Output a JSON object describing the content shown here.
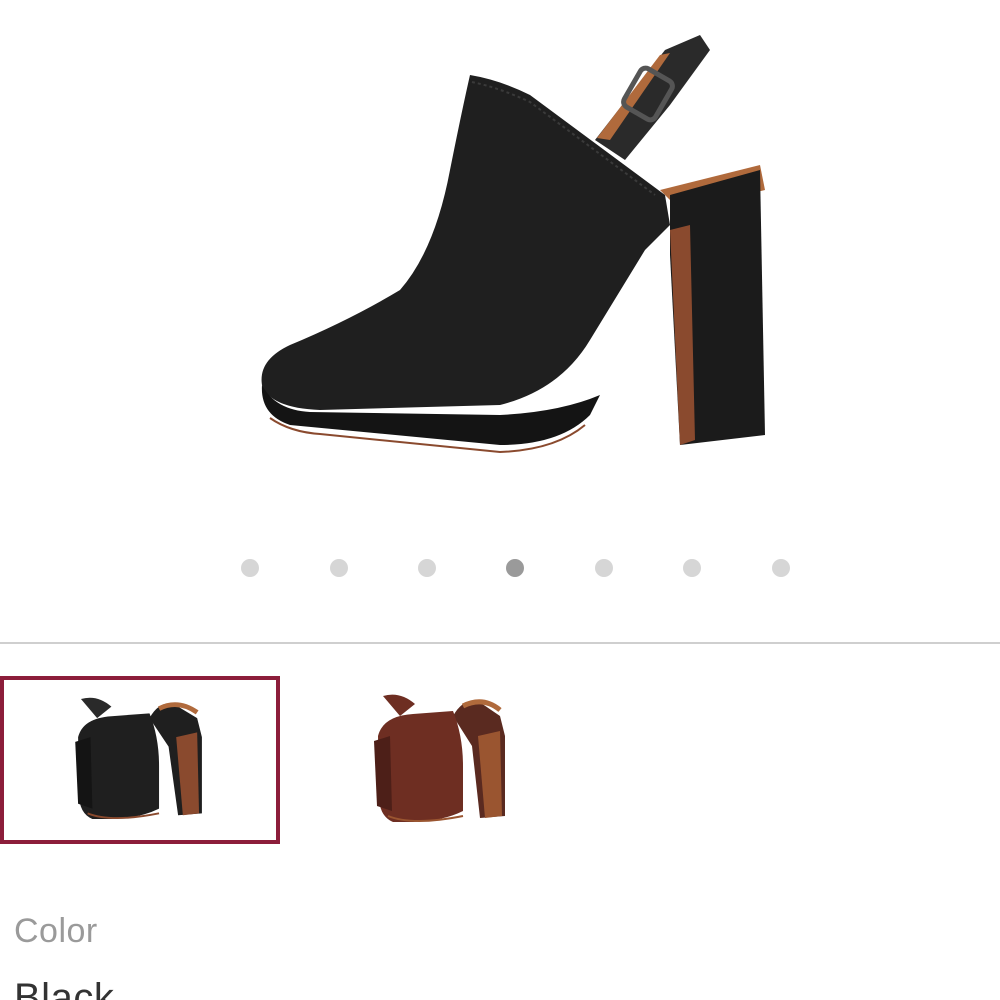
{
  "product": {
    "main_image": {
      "icon": "black-slingback-mule-image",
      "colors": {
        "leather": "#1f1f1f",
        "sole": "#8a4a2e",
        "lining": "#b06a3c"
      }
    },
    "carousel": {
      "total": 7,
      "active_index": 3,
      "colors": {
        "inactive": "#d6d6d6",
        "active": "#9a9a9a"
      }
    },
    "swatches": [
      {
        "name": "black-swatch",
        "selected": true,
        "color": "#1f1f1f"
      },
      {
        "name": "brown-swatch",
        "selected": false,
        "color": "#6e2e22"
      }
    ],
    "selection_color": "#8c1d3a",
    "color_label": "Color",
    "color_value": "Black"
  }
}
